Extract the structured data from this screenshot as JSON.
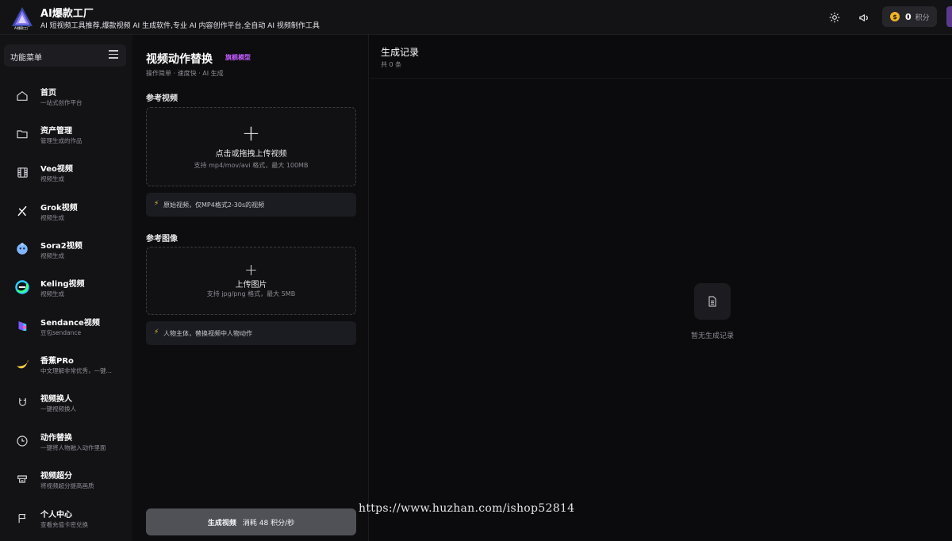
{
  "header": {
    "app_title": "AI爆款工厂",
    "app_subtitle": "AI 短视频工具推荐,爆款视频 AI 生成软件,专业 AI 内容创作平台,全自动 AI 视频制作工具",
    "logo_text": "AI爆款工厂",
    "points_value": "0",
    "points_unit": "积分",
    "coin_symbol": "$"
  },
  "sidebar": {
    "menu_label": "功能菜单",
    "items": [
      {
        "title": "首页",
        "desc": "一站式创作平台",
        "icon": "home-icon"
      },
      {
        "title": "资产管理",
        "desc": "管理生成的作品",
        "icon": "folder-icon"
      },
      {
        "title": "Veo视频",
        "desc": "视频生成",
        "icon": "film-icon"
      },
      {
        "title": "Grok视频",
        "desc": "视频生成",
        "icon": "grok-logo-icon"
      },
      {
        "title": "Sora2视频",
        "desc": "视频生成",
        "icon": "sora-logo-icon"
      },
      {
        "title": "Keling视频",
        "desc": "视频生成",
        "icon": "keling-logo-icon"
      },
      {
        "title": "Sendance视频",
        "desc": "豆包sendance",
        "icon": "sendance-logo-icon"
      },
      {
        "title": "香蕉PRo",
        "desc": "中文理解非常优秀，一键…",
        "icon": "banana-icon"
      },
      {
        "title": "视频换人",
        "desc": "一键视频换人",
        "icon": "magnet-icon"
      },
      {
        "title": "动作替换",
        "desc": "一键将人物融入动作里面",
        "icon": "clock-icon"
      },
      {
        "title": "视频超分",
        "desc": "将视频超分提高画质",
        "icon": "upscale-icon"
      },
      {
        "title": "个人中心",
        "desc": "查看充值卡密兑换",
        "icon": "flag-icon"
      }
    ]
  },
  "form": {
    "title": "视频动作替换",
    "badge": "旗舰模型",
    "subtitle": "操作简单 · 速度快 · AI 生成",
    "video_section_label": "参考视频",
    "video_upload_title": "点击或拖拽上传视频",
    "video_upload_hint": "支持 mp4/mov/avi 格式，最大 100MB",
    "video_note": "原始视频，仅MP4格式2-30s的视频",
    "image_section_label": "参考图像",
    "image_upload_title": "上传图片",
    "image_upload_hint": "支持 jpg/png 格式，最大 5MB",
    "image_note": "人物主体，替换视频中人物动作",
    "generate_label": "生成视频",
    "generate_cost": "消耗 48 积分/秒"
  },
  "records": {
    "title": "生成记录",
    "count": "共 0 条",
    "empty_text": "暂无生成记录"
  },
  "watermark": "https://www.huzhan.com/ishop52814"
}
